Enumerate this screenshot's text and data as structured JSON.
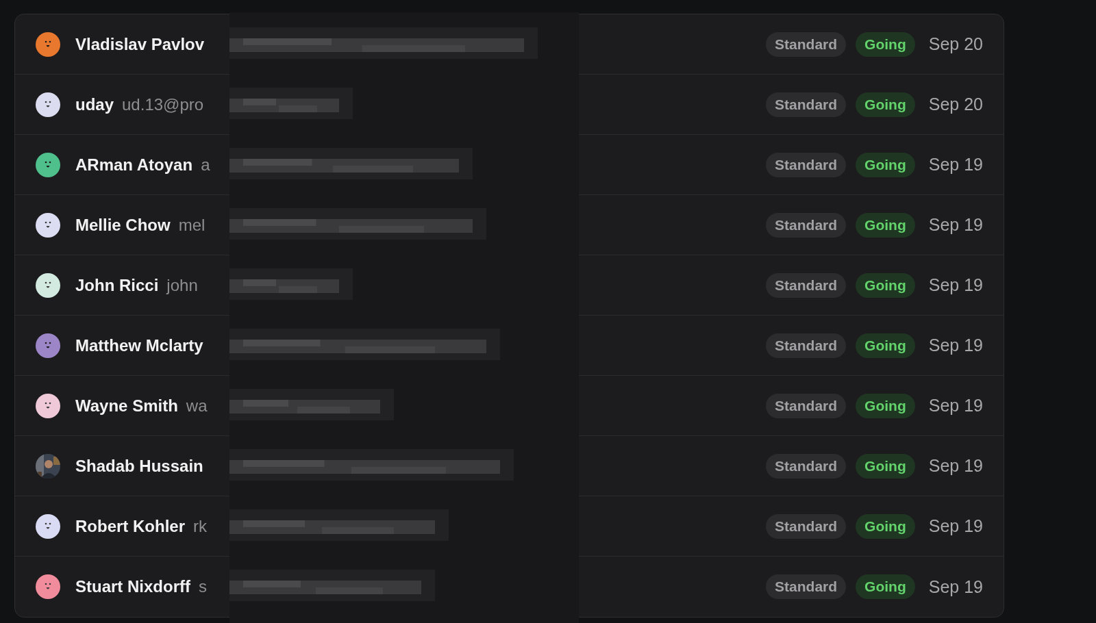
{
  "rows": [
    {
      "name": "Vladislav Pavlov",
      "email": "",
      "avatar": {
        "kind": "face",
        "color": "#e8782e"
      },
      "plan": "Standard",
      "status": {
        "label": "Going",
        "kind": "going"
      },
      "date": "Sep 20"
    },
    {
      "name": "uday",
      "email": "ud.13@pro",
      "avatar": {
        "kind": "face",
        "color": "#dcdcf0"
      },
      "plan": "Standard",
      "status": {
        "label": "Going",
        "kind": "going"
      },
      "date": "Sep 20"
    },
    {
      "name": "ARman Atoyan",
      "email": "a",
      "avatar": {
        "kind": "face",
        "color": "#4fbf8c"
      },
      "plan": "Standard",
      "status": {
        "label": "Going",
        "kind": "going"
      },
      "date": "Sep 19"
    },
    {
      "name": "Mellie Chow",
      "email": "mel",
      "avatar": {
        "kind": "face",
        "color": "#dcdcf2"
      },
      "plan": "Standard",
      "status": {
        "label": "Going",
        "kind": "going"
      },
      "date": "Sep 19"
    },
    {
      "name": "John Ricci",
      "email": "john",
      "avatar": {
        "kind": "face",
        "color": "#d2eadf"
      },
      "plan": "Standard",
      "status": {
        "label": "Going",
        "kind": "going"
      },
      "date": "Sep 19"
    },
    {
      "name": "Matthew Mclarty",
      "email": "",
      "avatar": {
        "kind": "face",
        "color": "#9d86c8"
      },
      "plan": "Standard",
      "status": {
        "label": "Going",
        "kind": "going"
      },
      "date": "Sep 19"
    },
    {
      "name": "Wayne Smith",
      "email": "wa",
      "avatar": {
        "kind": "face",
        "color": "#f0c9d9"
      },
      "plan": "Standard",
      "status": {
        "label": "Going",
        "kind": "going"
      },
      "date": "Sep 19"
    },
    {
      "name": "Shadab Hussain",
      "email": "",
      "plan": "Standard",
      "status": {
        "label": "Going",
        "kind": "going"
      },
      "date": "Sep 19"
    },
    {
      "name": "Robert Kohler",
      "email": "rk",
      "avatar": {
        "kind": "face",
        "color": "#d9dbf5"
      },
      "plan": "Standard",
      "status": {
        "label": "Going",
        "kind": "going"
      },
      "date": "Sep 19"
    },
    {
      "name": "Stuart Nixdorff",
      "email": "s",
      "avatar": {
        "kind": "face",
        "color": "#f08c9c"
      },
      "plan": "Standard",
      "status": {
        "label": "Going",
        "kind": "going"
      },
      "date": "Sep 19"
    }
  ]
}
